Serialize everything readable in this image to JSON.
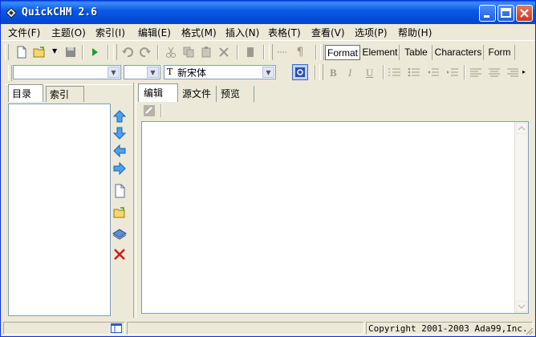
{
  "window": {
    "title": "QuickCHM 2.6"
  },
  "menu": {
    "items": [
      "文件(F)",
      "主题(O)",
      "索引(I)",
      "编辑(E)",
      "格式(M)",
      "插入(N)",
      "表格(T)",
      "查看(V)",
      "选项(P)",
      "帮助(H)"
    ]
  },
  "toolbar": {
    "format_tabs": [
      "Format",
      "Element",
      "Table",
      "Characters",
      "Form"
    ],
    "font_combo_value": "新宋体",
    "style_combo_value": "",
    "size_combo_value": ""
  },
  "left_panel": {
    "tabs": [
      "目录",
      "索引"
    ]
  },
  "editor_panel": {
    "tabs": [
      "编辑",
      "源文件",
      "预览"
    ]
  },
  "statusbar": {
    "copyright": "Copyright 2001-2003  Ada99,Inc."
  }
}
